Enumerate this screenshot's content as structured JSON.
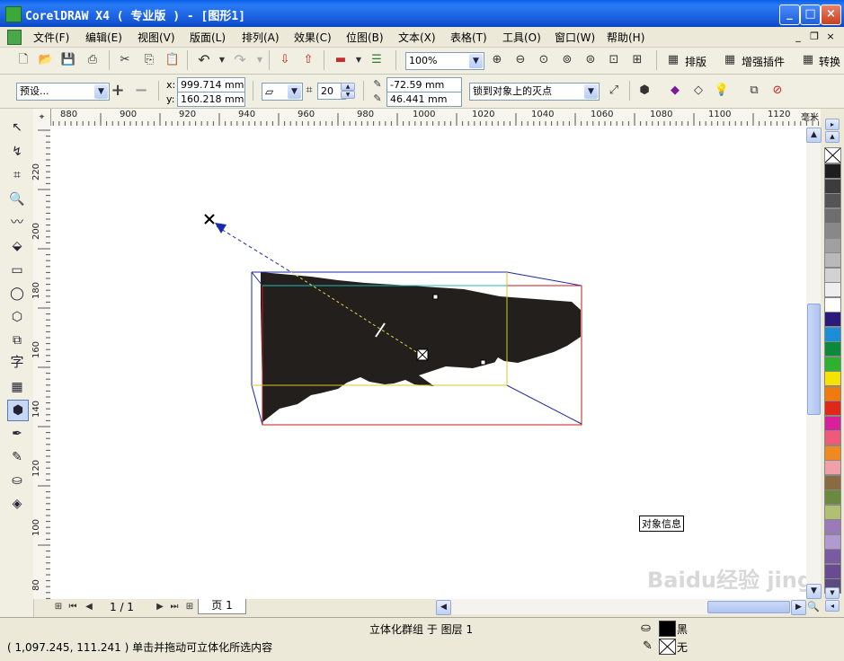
{
  "window": {
    "title": "CorelDRAW X4 ( 专业版 ) - [图形1]",
    "minimize": "_",
    "maximize": "□",
    "close": "×"
  },
  "menu": [
    "文件(F)",
    "编辑(E)",
    "视图(V)",
    "版面(L)",
    "排列(A)",
    "效果(C)",
    "位图(B)",
    "文本(X)",
    "表格(T)",
    "工具(O)",
    "窗口(W)",
    "帮助(H)"
  ],
  "mdi_controls": [
    "_",
    "❐",
    "×"
  ],
  "standard_toolbar": {
    "zoom_level": "100%",
    "plugin_buttons": [
      "排版",
      "增强插件",
      "转换"
    ]
  },
  "property_bar": {
    "preset": "预设...",
    "x_label": "x:",
    "x_value": "999.714 mm",
    "y_label": "y:",
    "y_value": "160.218 mm",
    "depth_value": "20",
    "vp_x": "-72.59 mm",
    "vp_y": "46.441 mm",
    "vanishing_point_mode": "锁到对象上的灭点"
  },
  "ruler": {
    "unit": "毫米",
    "h_ticks": [
      "880",
      "900",
      "920",
      "940",
      "960",
      "980",
      "1000",
      "1020",
      "1040",
      "1060",
      "1080",
      "1100",
      "1120"
    ],
    "v_ticks": [
      "220",
      "200",
      "180",
      "160",
      "140",
      "120",
      "100",
      "80"
    ]
  },
  "canvas": {
    "tooltip": "对象信息",
    "object_fill": "#231f1c"
  },
  "page_nav": {
    "counter": "1 / 1",
    "page_tab": "页 1"
  },
  "status": {
    "object_info": "立体化群组 于 图层 1",
    "hint": "( 1,097.245, 111.241 ) 单击并拖动可立体化所选内容",
    "fill_label": "黑",
    "outline_label": "无"
  },
  "watermark": "Baidu经验 jingyan.baidu.com",
  "palette_colors": [
    "#1e1e1e",
    "#3c3c3c",
    "#555555",
    "#6e6e6e",
    "#888888",
    "#a0a0a0",
    "#b9b9b9",
    "#d2d2d2",
    "#eeeeee",
    "#ffffff",
    "#2b1a7a",
    "#1a8fd8",
    "#0a8a3a",
    "#2fb02f",
    "#f5e400",
    "#f07a10",
    "#e02818",
    "#d8209a",
    "#f05a7a",
    "#f08a20",
    "#f0a0a8",
    "#8a6a40",
    "#6a8a40",
    "#b0c070",
    "#9a7ab8",
    "#b09ad0",
    "#7a5aa0",
    "#6a4a90",
    "#5a4a80"
  ]
}
